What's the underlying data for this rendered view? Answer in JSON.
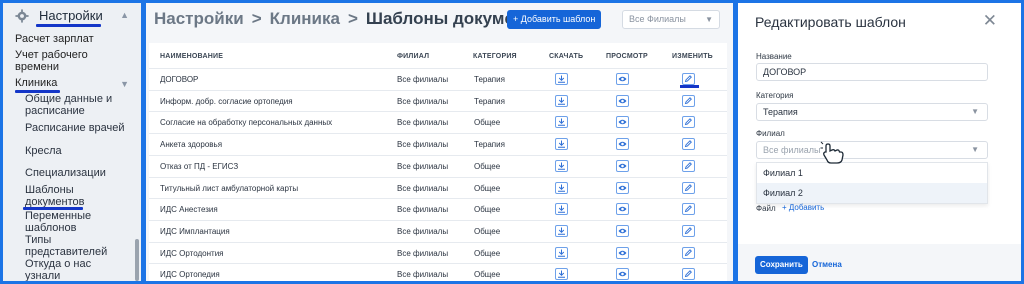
{
  "sidebar": {
    "title": "Настройки",
    "items": [
      {
        "label": "Расчет зарплат"
      },
      {
        "label": "Учет рабочего"
      },
      {
        "label": "времени"
      },
      {
        "label": "Клиника"
      }
    ],
    "sub_items": [
      {
        "label": "Общие данные и"
      },
      {
        "label": "расписание"
      },
      {
        "label": "Расписание врачей"
      },
      {
        "label": "Кресла"
      },
      {
        "label": "Специализации"
      },
      {
        "label": "Шаблоны"
      },
      {
        "label": "документов"
      },
      {
        "label": "Переменные"
      },
      {
        "label": "шаблонов"
      },
      {
        "label": "Типы"
      },
      {
        "label": "представителей"
      },
      {
        "label": "Откуда о нас"
      },
      {
        "label": "узнали"
      }
    ],
    "icons": {
      "settings": "gear-icon",
      "expand": "chevron-down-icon"
    }
  },
  "main": {
    "breadcrumbs": [
      "Настройки",
      "Клиника",
      "Шаблоны документов"
    ],
    "separator": ">",
    "add_button": "+ Добавить шаблон",
    "filter_placeholder": "Все Филиалы",
    "columns": {
      "name": "НАИМЕНОВАНИЕ",
      "branch": "ФИЛИАЛ",
      "category": "КАТЕГОРИЯ",
      "download": "СКАЧАТЬ",
      "view": "ПРОСМОТР",
      "edit": "ИЗМЕНИТЬ"
    },
    "rows": [
      {
        "name": "ДОГОВОР",
        "branch": "Все филиалы",
        "category": "Терапия"
      },
      {
        "name": "Информ. добр. согласие ортопедия",
        "branch": "Все филиалы",
        "category": "Терапия"
      },
      {
        "name": "Согласие на обработку персональных данных",
        "branch": "Все филиалы",
        "category": "Общее"
      },
      {
        "name": "Анкета здоровья",
        "branch": "Все филиалы",
        "category": "Терапия"
      },
      {
        "name": "Отказ от ПД - ЕГИСЗ",
        "branch": "Все филиалы",
        "category": "Общее"
      },
      {
        "name": "Титульный лист амбулаторной карты",
        "branch": "Все филиалы",
        "category": "Общее"
      },
      {
        "name": "ИДС Анестезия",
        "branch": "Все филиалы",
        "category": "Общее"
      },
      {
        "name": "ИДС Имплантация",
        "branch": "Все филиалы",
        "category": "Общее"
      },
      {
        "name": "ИДС Ортодонтия",
        "branch": "Все филиалы",
        "category": "Общее"
      },
      {
        "name": "ИДС Ортопедия",
        "branch": "Все филиалы",
        "category": "Общее"
      }
    ],
    "icons": {
      "download": "download-icon",
      "view": "eye-icon",
      "edit": "pencil-icon"
    }
  },
  "editor": {
    "title": "Редактировать шаблон",
    "close": "✕",
    "name_label": "Название",
    "name_value": "ДОГОВОР",
    "category_label": "Категория",
    "category_value": "Терапия",
    "branch_label": "Филиал",
    "branch_placeholder": "Все филиалы",
    "branch_options": [
      "Филиал 1",
      "Филиал 2"
    ],
    "file_label": "Файл",
    "add_file": "+ Добавить",
    "save_button": "Сохранить",
    "cancel_button": "Отмена"
  },
  "colors": {
    "accent": "#1565d8",
    "frame": "#1c74e6",
    "underline": "#1436c8"
  }
}
